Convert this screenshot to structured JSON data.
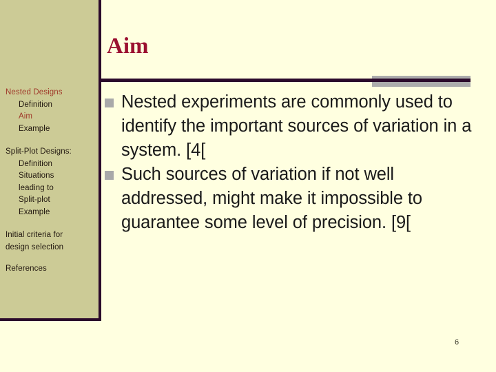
{
  "slide": {
    "title": "Aim",
    "page_number": "6",
    "colors": {
      "sidebar_background": "#CCCB96",
      "main_background": "#FFFFE0",
      "border": "#2B0A2B",
      "title_text": "#9B1030",
      "accent_text": "#A0392A",
      "body_text": "#1A1A1A",
      "bullet_marker": "#A9A9A9",
      "divider_block": "#ACACAC"
    }
  },
  "sidebar": {
    "groups": [
      {
        "items": [
          {
            "label": "Nested Designs",
            "level": 1,
            "accent": true
          },
          {
            "label": "Definition",
            "level": 2,
            "accent": false
          },
          {
            "label": "Aim",
            "level": 2,
            "accent": true
          },
          {
            "label": "Example",
            "level": 2,
            "accent": false
          }
        ]
      },
      {
        "items": [
          {
            "label": "Split-Plot Designs:",
            "level": 1,
            "accent": false
          },
          {
            "label": "Definition",
            "level": 2,
            "accent": false
          },
          {
            "label": "Situations",
            "level": 2,
            "accent": false
          },
          {
            "label": "leading to",
            "level": 2,
            "accent": false
          },
          {
            "label": "Split-plot",
            "level": 2,
            "accent": false
          },
          {
            "label": "Example",
            "level": 2,
            "accent": false
          }
        ]
      },
      {
        "items": [
          {
            "label": "Initial criteria for",
            "level": 1,
            "accent": false
          },
          {
            "label": "design selection",
            "level": 1,
            "accent": false
          }
        ]
      },
      {
        "items": [
          {
            "label": "References",
            "level": 1,
            "accent": false
          }
        ]
      }
    ]
  },
  "body": {
    "bullets": [
      {
        "marker": "square-bullet-icon",
        "text": "Nested experiments are commonly used to identify the important sources of variation in a system. [4["
      },
      {
        "marker": "square-bullet-icon",
        "text": "Such sources of variation if not well addressed, might make it impossible to guarantee some level of precision. [9["
      }
    ]
  }
}
